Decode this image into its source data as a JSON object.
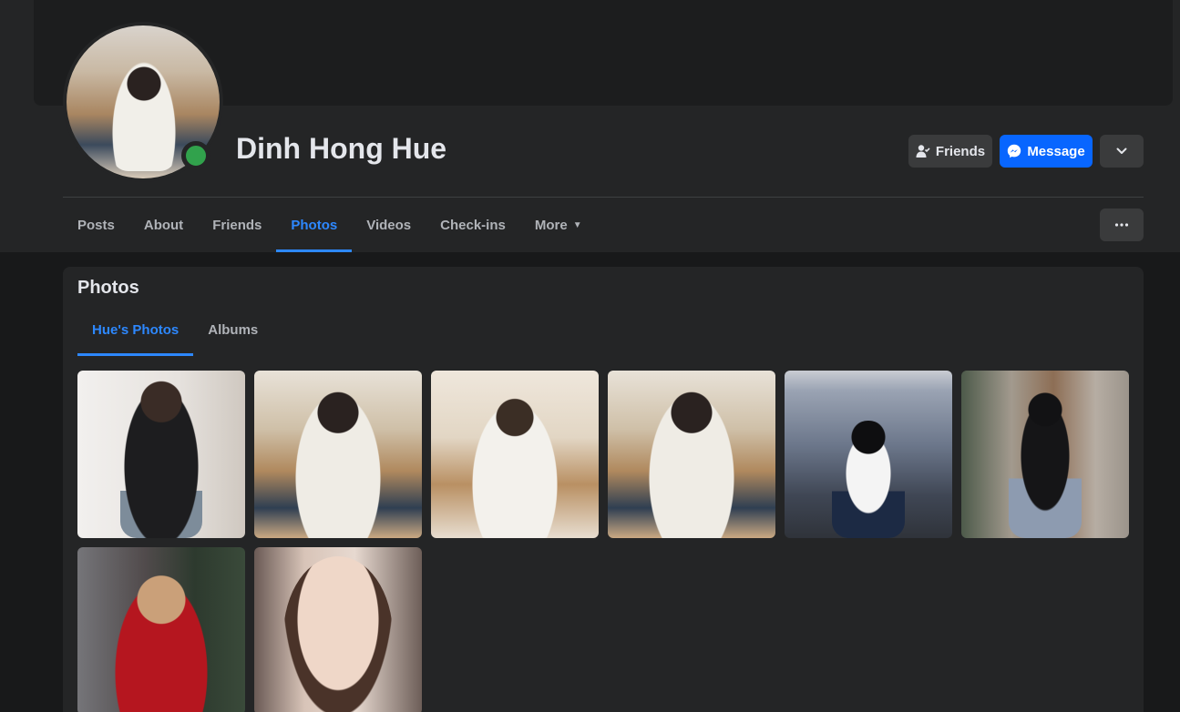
{
  "profile": {
    "name": "Dinh Hong Hue",
    "online": true
  },
  "actions": {
    "friends_label": "Friends",
    "message_label": "Message"
  },
  "tabs": [
    {
      "label": "Posts",
      "active": false
    },
    {
      "label": "About",
      "active": false
    },
    {
      "label": "Friends",
      "active": false
    },
    {
      "label": "Photos",
      "active": true
    },
    {
      "label": "Videos",
      "active": false
    },
    {
      "label": "Check-ins",
      "active": false
    },
    {
      "label": "More",
      "active": false
    }
  ],
  "photos_section": {
    "title": "Photos",
    "subtabs": [
      {
        "label": "Hue's Photos",
        "active": true
      },
      {
        "label": "Albums",
        "active": false
      }
    ],
    "photo_count_visible": 8
  },
  "colors": {
    "accent": "#2d88ff",
    "message_button": "#0866ff",
    "online": "#31a24c",
    "surface": "#242526",
    "background": "#18191a"
  },
  "icons": {
    "friends": "user-check-icon",
    "message": "messenger-icon",
    "dropdown": "chevron-down-icon",
    "more_options": "ellipsis-icon"
  }
}
